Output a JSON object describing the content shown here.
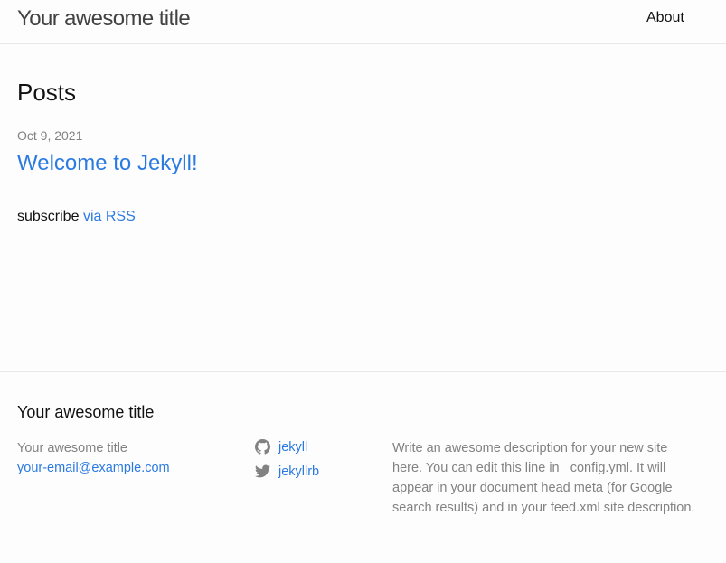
{
  "header": {
    "site_title": "Your awesome title",
    "nav": {
      "about_label": "About"
    }
  },
  "main": {
    "heading": "Posts",
    "posts": [
      {
        "date": "Oct 9, 2021",
        "title": "Welcome to Jekyll!"
      }
    ],
    "subscribe": {
      "prefix": "subscribe",
      "link_label": "via RSS"
    }
  },
  "footer": {
    "heading": "Your awesome title",
    "name": "Your awesome title",
    "email": "your-email@example.com",
    "social": [
      {
        "icon": "github-icon",
        "label": "jekyll"
      },
      {
        "icon": "twitter-icon",
        "label": "jekyllrb"
      }
    ],
    "description": "Write an awesome description for your new site here. You can edit this line in _config.yml. It will appear in your document head meta (for Google search results) and in your feed.xml site description."
  },
  "colors": {
    "link": "#2a7ae2",
    "muted": "#828282",
    "text": "#111111",
    "title": "#424242",
    "border": "#e8e8e8",
    "background": "#fdfdfd"
  }
}
